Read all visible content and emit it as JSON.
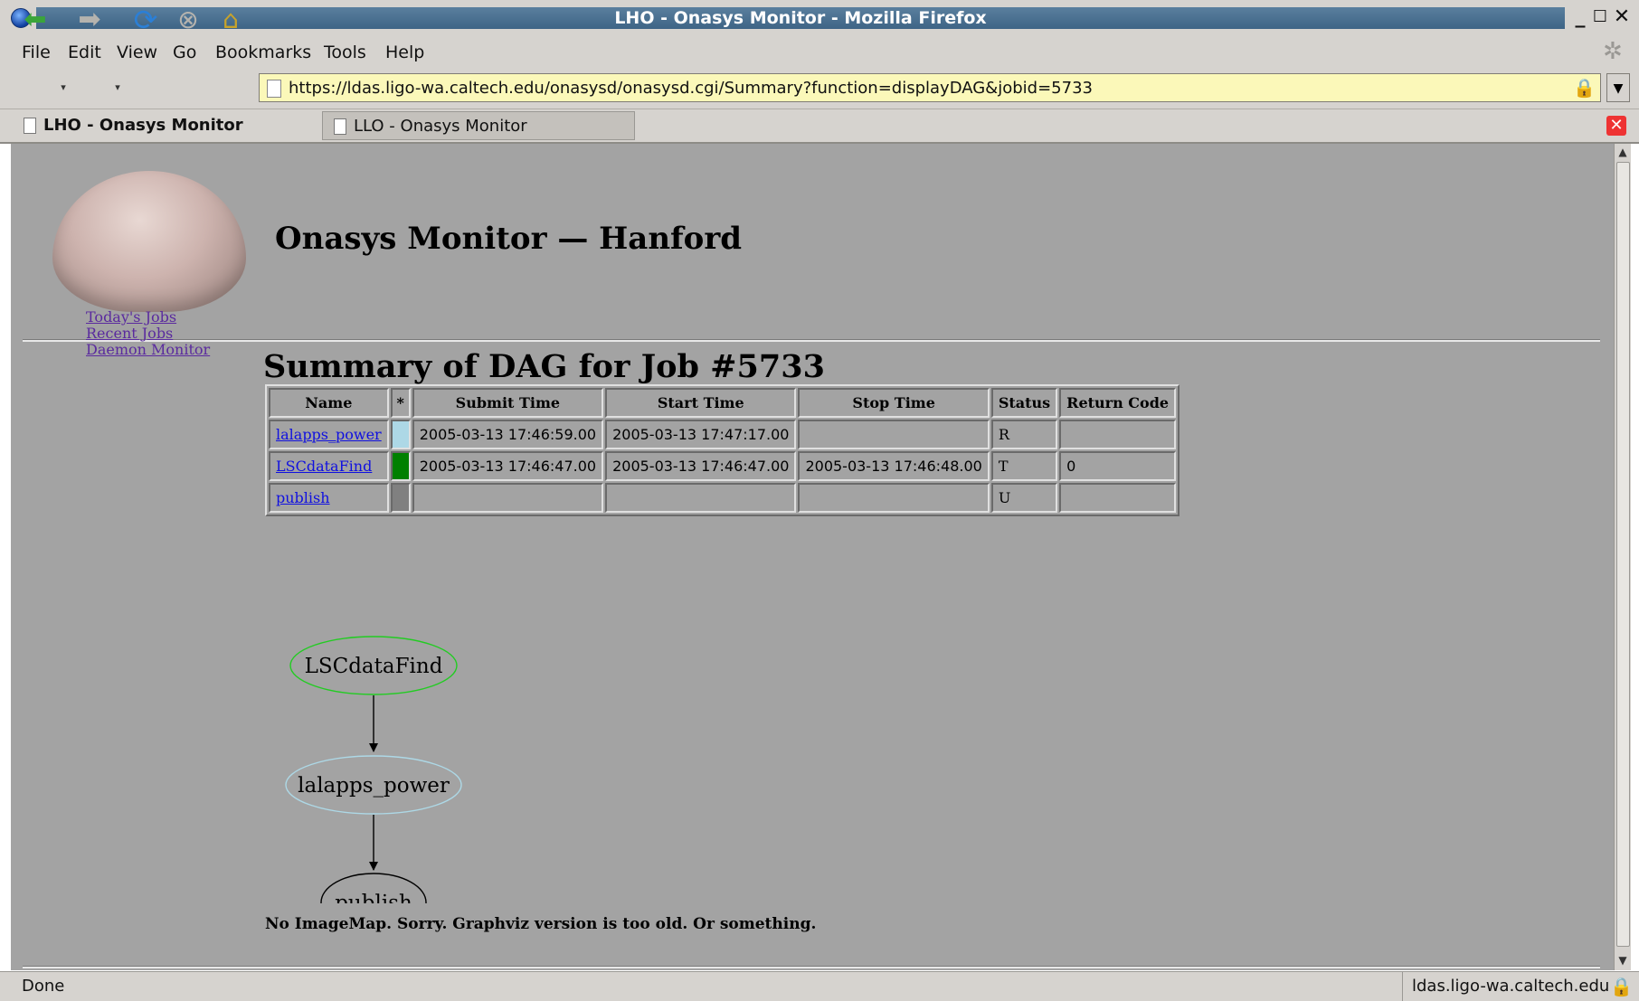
{
  "window": {
    "title": "LHO - Onasys Monitor - Mozilla Firefox",
    "controls": {
      "minimize": "_",
      "maximize": "☐",
      "close": "✕"
    }
  },
  "menu": [
    "File",
    "Edit",
    "View",
    "Go",
    "Bookmarks",
    "Tools",
    "Help"
  ],
  "toolbar": {
    "back_icon": "back-arrow",
    "forward_icon": "forward-arrow",
    "reload_icon": "reload",
    "stop_icon": "stop",
    "home_icon": "home",
    "url": "https://ldas.ligo-wa.caltech.edu/onasysd/onasysd.cgi/Summary?function=displayDAG&jobid=5733"
  },
  "tabs": [
    {
      "label": "LHO - Onasys Monitor",
      "active": true
    },
    {
      "label": "LLO - Onasys Monitor",
      "active": false
    }
  ],
  "page": {
    "site_title": "Onasys Monitor — Hanford",
    "nav_links": [
      "Today's  Jobs",
      "Recent Jobs",
      "Daemon Monitor"
    ],
    "heading": "Summary of DAG for Job #5733",
    "table": {
      "headers": [
        "Name",
        "*",
        "Submit Time",
        "Start Time",
        "Stop Time",
        "Status",
        "Return Code"
      ],
      "rows": [
        {
          "name": "lalapps_power",
          "color": "#add8e6",
          "submit": "2005-03-13 17:46:59.00",
          "start": "2005-03-13 17:47:17.00",
          "stop": "",
          "status": "R",
          "return_code": ""
        },
        {
          "name": "LSCdataFind",
          "color": "#008000",
          "submit": "2005-03-13 17:46:47.00",
          "start": "2005-03-13 17:46:47.00",
          "stop": "2005-03-13 17:46:48.00",
          "status": "T",
          "return_code": "0"
        },
        {
          "name": "publish",
          "color": "#808080",
          "submit": "",
          "start": "",
          "stop": "",
          "status": "U",
          "return_code": ""
        }
      ]
    },
    "dag": {
      "nodes": [
        {
          "label": "LSCdataFind",
          "color": "#22cc22"
        },
        {
          "label": "lalapps_power",
          "color": "#add8e6"
        },
        {
          "label": "publish",
          "color": "#000000"
        }
      ],
      "edges": [
        [
          "LSCdataFind",
          "lalapps_power"
        ],
        [
          "lalapps_power",
          "publish"
        ]
      ]
    },
    "note": "No ImageMap. Sorry. Graphviz version is too old. Or something."
  },
  "status": {
    "text": "Done",
    "host": "ldas.ligo-wa.caltech.edu"
  },
  "colors": {
    "content_bg": "#a3a3a3",
    "chrome_bg": "#d6d3cf",
    "url_bg": "#fbf8b9",
    "visited_link": "#5a2a9e",
    "link": "#1010e0"
  }
}
